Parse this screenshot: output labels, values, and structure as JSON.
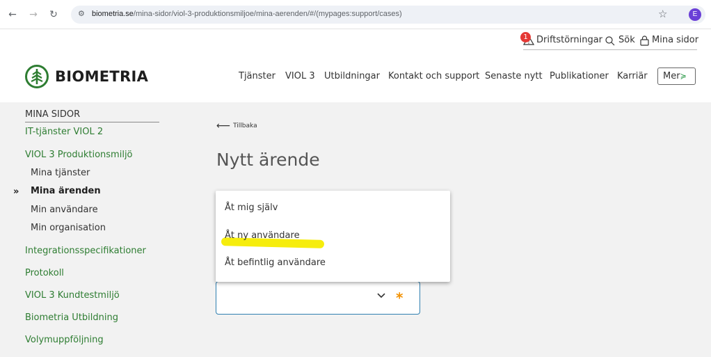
{
  "browser": {
    "url_domain": "biometria.se",
    "url_path": "/mina-sidor/viol-3-produktionsmiljoe/mina-aerenden/#/(mypages:support/cases)",
    "profile_initial": "E"
  },
  "utility": {
    "notification_count": "1",
    "disruptions_label": "Driftstörningar",
    "search_label": "Sök",
    "my_pages_label": "Mina sidor"
  },
  "header": {
    "logo_text": "BIOMETRIA",
    "nav": [
      "Tjänster",
      "VIOL 3",
      "Utbildningar",
      "Kontakt och support",
      "Senaste nytt",
      "Publikationer",
      "Karriär"
    ],
    "more_label": "Mer"
  },
  "sidebar": {
    "heading": "MINA SIDOR",
    "items": [
      {
        "label": "IT-tjänster VIOL 2"
      },
      {
        "label": "VIOL 3 Produktionsmiljö"
      },
      {
        "label": "Mina tjänster"
      },
      {
        "label": "Mina ärenden"
      },
      {
        "label": "Min användare"
      },
      {
        "label": "Min organisation"
      },
      {
        "label": "Integrationsspecifikationer"
      },
      {
        "label": "Protokoll"
      },
      {
        "label": "VIOL 3 Kundtestmiljö"
      },
      {
        "label": "Biometria Utbildning"
      },
      {
        "label": "Volymuppföljning"
      }
    ]
  },
  "content": {
    "back_label": "Tillbaka",
    "title": "Nytt ärende",
    "dropdown_options": [
      "Åt mig själv",
      "Åt ny användare",
      "Åt befintlig användare"
    ],
    "required_mark": "*",
    "colors": {
      "brand_green": "#2e7d32",
      "focus_blue": "#2f7fb0",
      "required_orange": "#f29100",
      "highlight_yellow": "#f5ec00"
    }
  }
}
